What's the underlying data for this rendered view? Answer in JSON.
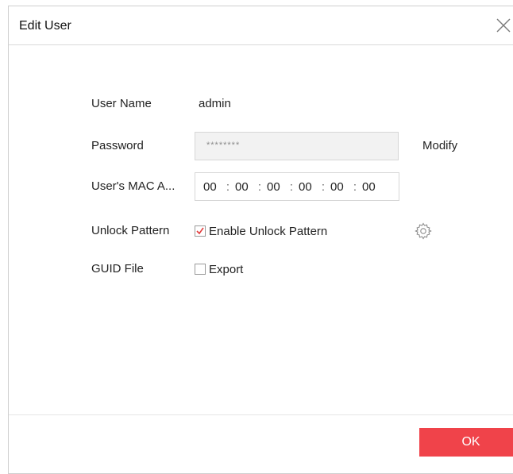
{
  "dialog": {
    "title": "Edit User",
    "close_icon": "close-icon"
  },
  "form": {
    "username": {
      "label": "User Name",
      "value": "admin"
    },
    "password": {
      "label": "Password",
      "value": "********",
      "modify_label": "Modify"
    },
    "mac": {
      "label": "User's MAC A...",
      "segments": [
        "00",
        "00",
        "00",
        "00",
        "00",
        "00"
      ],
      "separator": ":"
    },
    "unlock_pattern": {
      "label": "Unlock Pattern",
      "checkbox_label": "Enable Unlock Pattern",
      "checked": true,
      "settings_icon": "gear-icon"
    },
    "guid_file": {
      "label": "GUID File",
      "checkbox_label": "Export",
      "checked": false
    }
  },
  "footer": {
    "ok_label": "OK"
  },
  "colors": {
    "accent": "#f0434a",
    "check": "#e23b3b"
  }
}
